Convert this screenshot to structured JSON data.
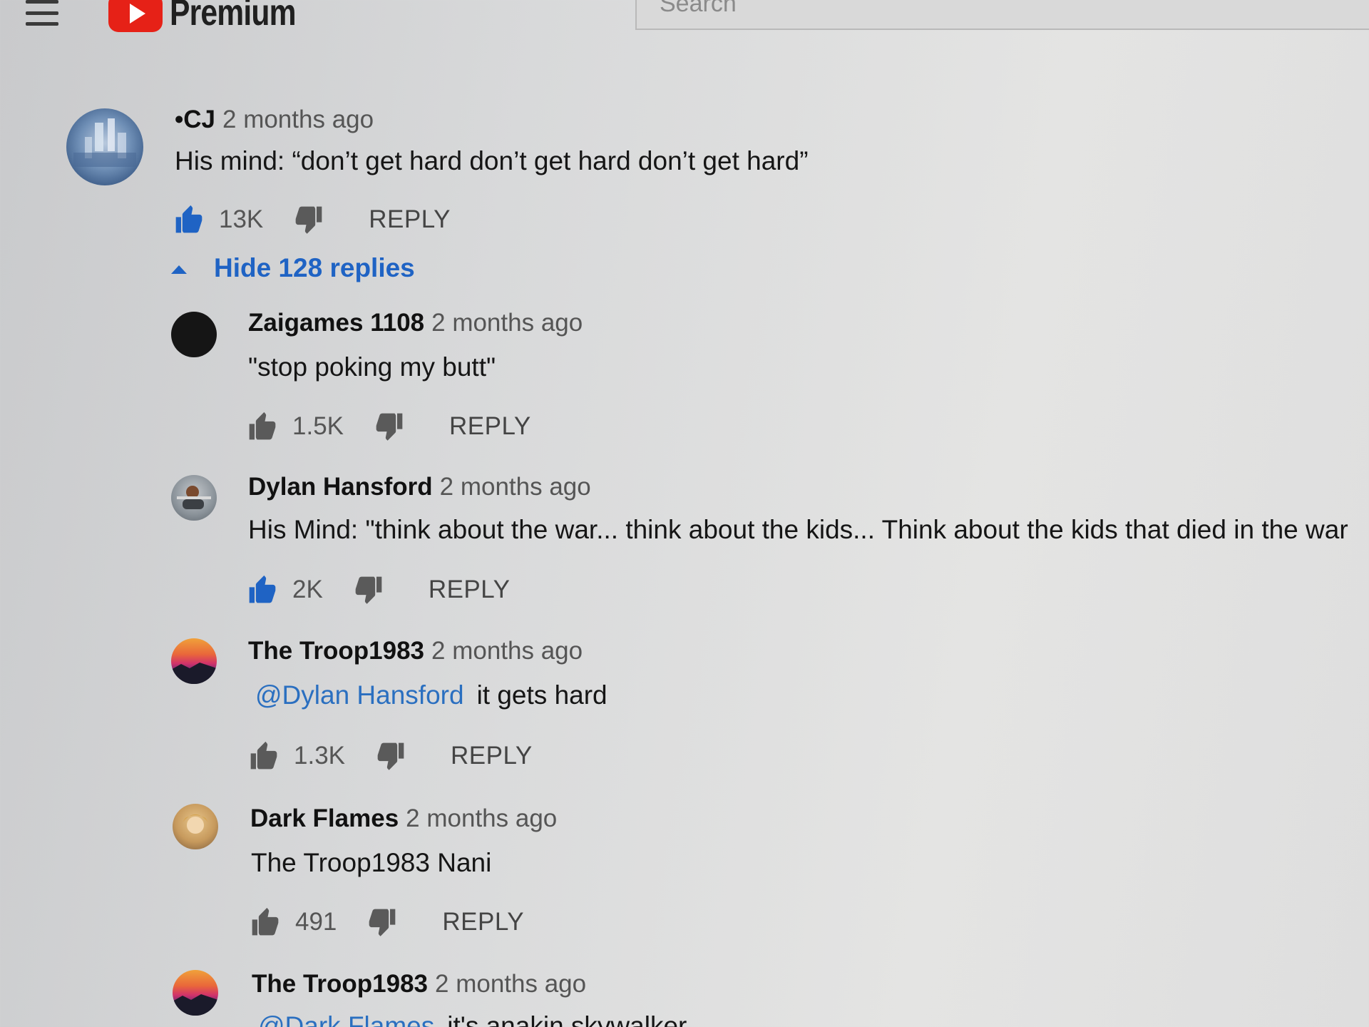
{
  "header": {
    "logo_text": "Premium",
    "search_placeholder": "Search"
  },
  "top_comment": {
    "author": "•CJ",
    "time": "2 months ago",
    "text": "His mind: “don’t  get hard don’t get hard don’t get hard”",
    "likes": "13K",
    "reply_label": "REPLY"
  },
  "replies_toggle": {
    "label": "Hide 128 replies"
  },
  "replies": [
    {
      "author": "Zaigames 1108",
      "time": "2 months ago",
      "mention": "",
      "text": "\"stop poking my butt\"",
      "likes": "1.5K",
      "reply_label": "REPLY"
    },
    {
      "author": "Dylan Hansford",
      "time": "2 months ago",
      "mention": "",
      "text": "His Mind: \"think about the war... think about the kids... Think about the kids that died in the war",
      "likes": "2K",
      "reply_label": "REPLY"
    },
    {
      "author": "The Troop1983",
      "time": "2 months ago",
      "mention": "@Dylan Hansford",
      "text": "it gets hard",
      "likes": "1.3K",
      "reply_label": "REPLY"
    },
    {
      "author": "Dark Flames",
      "time": "2 months ago",
      "mention": "",
      "text": "The Troop1983 Nani",
      "likes": "491",
      "reply_label": "REPLY"
    },
    {
      "author": "The Troop1983",
      "time": "2 months ago",
      "mention": "@Dark Flames",
      "text": "it's anakin skywalker",
      "likes": "",
      "reply_label": ""
    }
  ],
  "colors": {
    "link": "#1f63c4",
    "mention": "#2a6fc0",
    "logo_red": "#e62117"
  }
}
